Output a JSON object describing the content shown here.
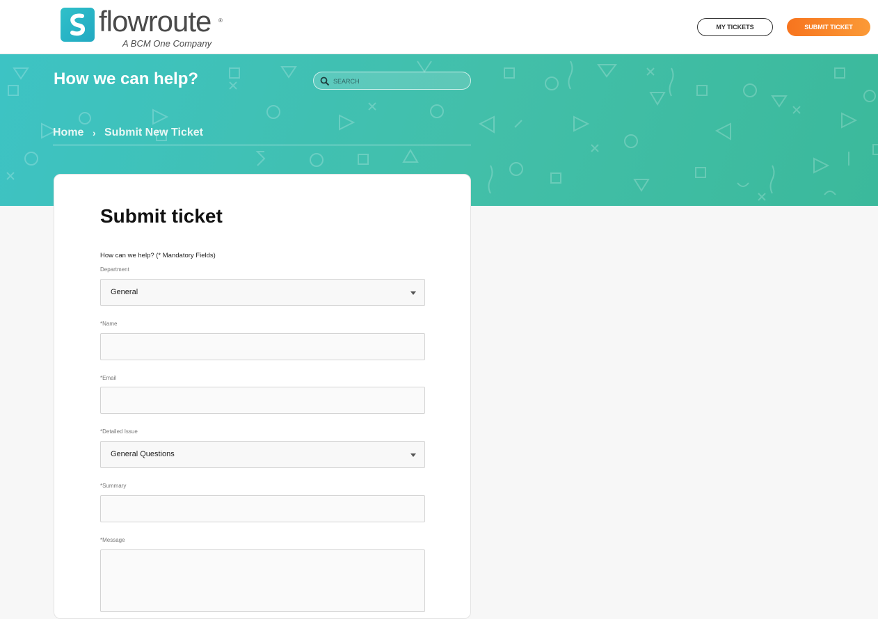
{
  "header": {
    "logo_word": "flowroute",
    "logo_reg": "®",
    "logo_tagline": "A BCM One Company",
    "my_tickets_label": "MY TICKETS",
    "submit_ticket_label": "SUBMIT TICKET"
  },
  "hero": {
    "title": "How we can help?",
    "search_placeholder": "SEARCH",
    "breadcrumb": {
      "home": "Home",
      "separator": "›",
      "current": "Submit New Ticket"
    }
  },
  "form": {
    "title": "Submit ticket",
    "intro": "How can we help? (* Mandatory Fields)",
    "fields": [
      {
        "label": "Department",
        "type": "select",
        "value": "General"
      },
      {
        "label": "*Name",
        "type": "text",
        "value": ""
      },
      {
        "label": "*Email",
        "type": "text",
        "value": ""
      },
      {
        "label": "*Detailed Issue",
        "type": "select",
        "value": "General Questions"
      },
      {
        "label": "*Summary",
        "type": "text",
        "value": ""
      },
      {
        "label": "*Message",
        "type": "textarea",
        "value": ""
      }
    ]
  },
  "colors": {
    "accent_orange": "#f7741e",
    "hero_teal": "#3dc3c4",
    "logo_teal": "#2ab8c6"
  },
  "icons": [
    "logo-mark-icon",
    "search-icon",
    "chevron-right-icon",
    "caret-down-icon"
  ]
}
